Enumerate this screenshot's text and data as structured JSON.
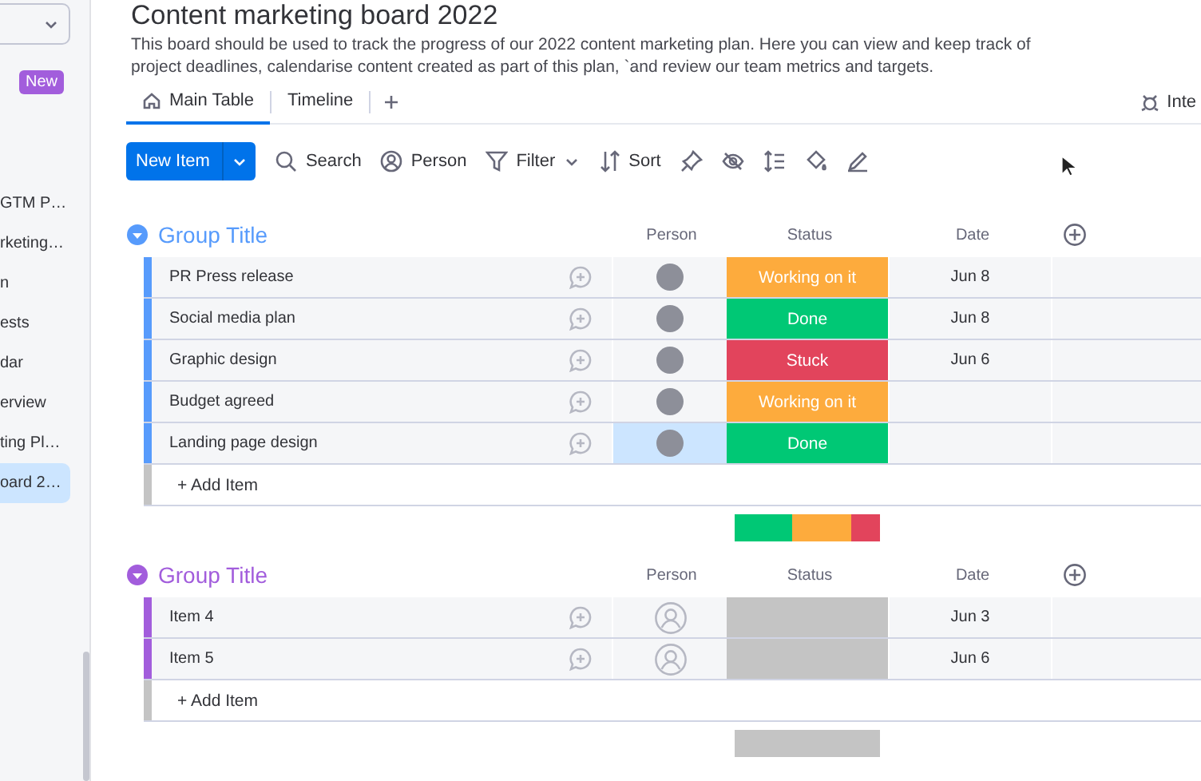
{
  "sidebar": {
    "badge": "New",
    "items": [
      {
        "label": "GTM P…",
        "selected": false
      },
      {
        "label": "rketing…",
        "selected": false
      },
      {
        "label": "n",
        "selected": false
      },
      {
        "label": "ests",
        "selected": false
      },
      {
        "label": "dar",
        "selected": false
      },
      {
        "label": "erview",
        "selected": false
      },
      {
        "label": "ting Pl…",
        "selected": false
      },
      {
        "label": "oard 2…",
        "selected": true
      }
    ]
  },
  "board": {
    "title": "Content marketing board 2022",
    "description": "This board should be used to track the progress of our 2022 content marketing plan. Here you can view and keep track of project deadlines, calendarise content created as part of this plan, `and review our team metrics and targets."
  },
  "tabs": [
    {
      "label": "Main Table",
      "selected": true
    },
    {
      "label": "Timeline",
      "selected": false
    }
  ],
  "integrate": "Inte",
  "toolbar": {
    "new_item": "New Item",
    "buttons": [
      {
        "kind": "search",
        "label": "Search"
      },
      {
        "kind": "person",
        "label": "Person"
      },
      {
        "kind": "filter",
        "label": "Filter"
      },
      {
        "kind": "sort",
        "label": "Sort"
      }
    ]
  },
  "groups": [
    {
      "title": "Group Title",
      "color": "#579bfc",
      "columns": [
        "Person",
        "Status",
        "Date"
      ],
      "add_item": "+ Add Item",
      "rows": [
        {
          "name": "PR Press release",
          "person": {
            "kind": "photo",
            "selected": false
          },
          "status": {
            "label": "Working on it",
            "color": "#fdab3d"
          },
          "date": "Jun 8"
        },
        {
          "name": "Social media plan",
          "person": {
            "kind": "photo",
            "selected": false
          },
          "status": {
            "label": "Done",
            "color": "#00c875"
          },
          "date": "Jun 8"
        },
        {
          "name": "Graphic design",
          "person": {
            "kind": "photo",
            "selected": false
          },
          "status": {
            "label": "Stuck",
            "color": "#e2445c"
          },
          "date": "Jun 6"
        },
        {
          "name": "Budget agreed",
          "person": {
            "kind": "photo",
            "selected": false
          },
          "status": {
            "label": "Working on it",
            "color": "#fdab3d"
          }
        },
        {
          "name": "Landing page design",
          "person": {
            "kind": "photo",
            "selected": true
          },
          "status": {
            "label": "Done",
            "color": "#00c875"
          }
        }
      ]
    },
    {
      "title": "Group Title",
      "color": "#a25ddc",
      "columns": [
        "Person",
        "Status",
        "Date"
      ],
      "add_item": "+ Add Item",
      "rows": [
        {
          "name": "Item 4",
          "person": {
            "kind": "empty",
            "selected": false
          },
          "status": {
            "color": "#c4c4c4"
          },
          "date": "Jun 3"
        },
        {
          "name": "Item 5",
          "person": {
            "kind": "empty",
            "selected": false
          },
          "status": {
            "color": "#c4c4c4"
          },
          "date": "Jun 6"
        }
      ]
    }
  ]
}
